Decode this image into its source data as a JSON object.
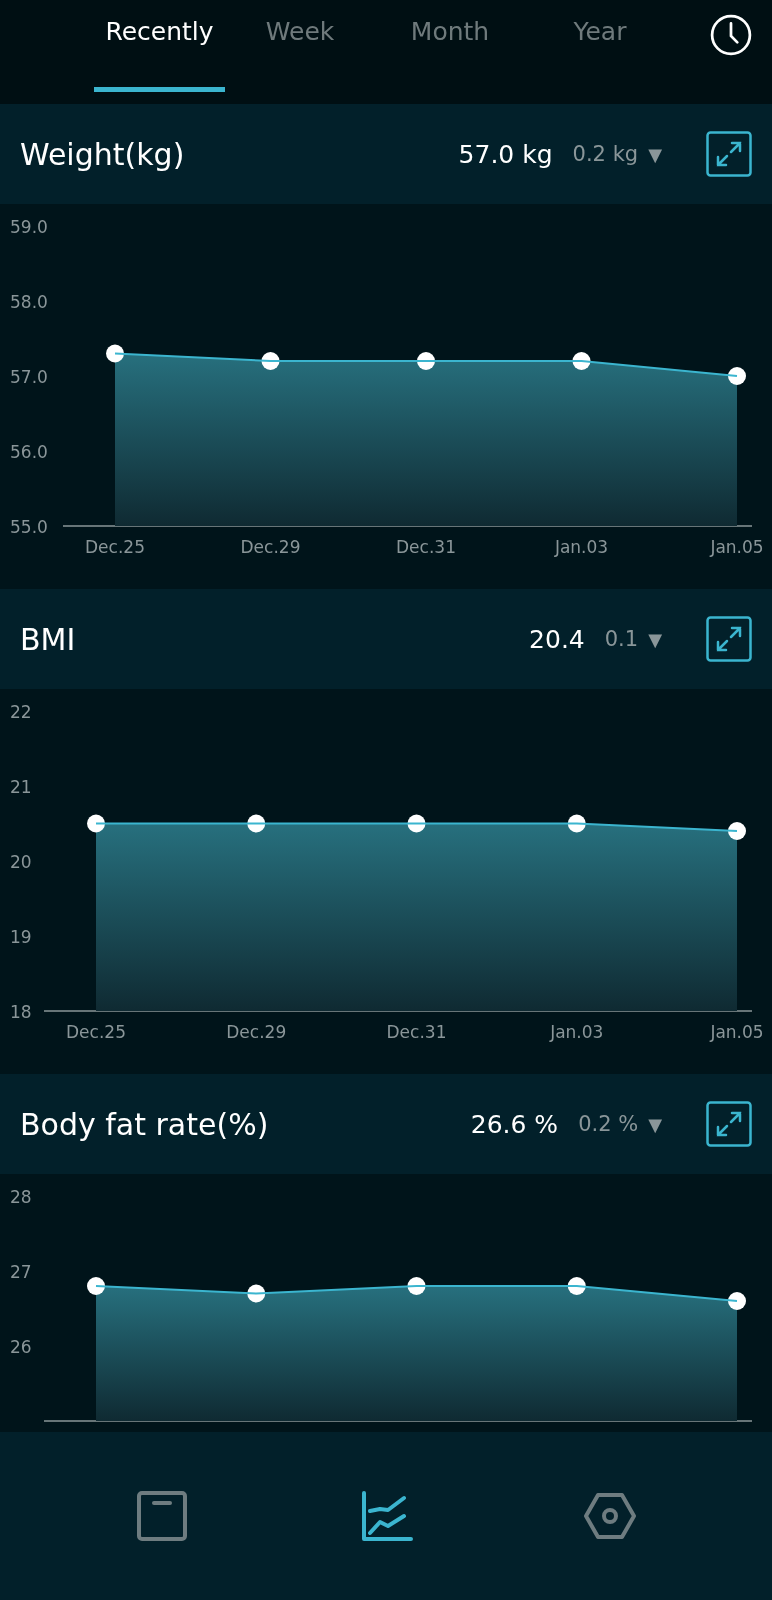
{
  "tabs": [
    {
      "label": "Recently",
      "selected": true
    },
    {
      "label": "Week",
      "selected": false
    },
    {
      "label": "Month",
      "selected": false
    },
    {
      "label": "Year",
      "selected": false
    }
  ],
  "sections": [
    {
      "title": "Weight(kg)",
      "value": "57.0 kg",
      "change": "0.2 kg",
      "trend_icon": "▼",
      "chart_data": {
        "type": "area",
        "categories": [
          "Dec.25",
          "Dec.29",
          "Dec.31",
          "Jan.03",
          "Jan.05"
        ],
        "series": [
          {
            "color": "#3bb5cf",
            "values": [
              57.3,
              57.2,
              57.2,
              57.2,
              57.0
            ]
          }
        ],
        "ylim": [
          55,
          59
        ],
        "yticks": [
          {
            "value": 55,
            "label": "55.0"
          },
          {
            "value": 56,
            "label": "56.0"
          },
          {
            "value": 57,
            "label": "57.0"
          },
          {
            "value": 58,
            "label": "58.0"
          },
          {
            "value": 59,
            "label": "59.0"
          }
        ]
      }
    },
    {
      "title": "BMI",
      "value": "20.4",
      "change": "0.1",
      "trend_icon": "▼",
      "chart_data": {
        "type": "area",
        "categories": [
          "Dec.25",
          "Dec.29",
          "Dec.31",
          "Jan.03",
          "Jan.05"
        ],
        "series": [
          {
            "color": "#3bb5cf",
            "values": [
              20.5,
              20.5,
              20.5,
              20.5,
              20.4
            ]
          }
        ],
        "ylim": [
          18,
          22
        ],
        "yticks": [
          18,
          19,
          20,
          21,
          22
        ]
      }
    },
    {
      "title": "Body fat rate(%)",
      "value": "26.6 %",
      "change": "0.2 %",
      "trend_icon": "▼",
      "chart_data": {
        "type": "area",
        "series": [
          {
            "color": "#3bb5cf",
            "values": [
              26.8,
              26.7,
              26.8,
              26.8,
              26.6
            ]
          }
        ],
        "ylim": [
          25,
          28
        ],
        "yticks": [
          26,
          27,
          28
        ]
      }
    }
  ],
  "bottom_nav": [
    {
      "kind": "scale",
      "selected": false
    },
    {
      "kind": "chart",
      "selected": true
    },
    {
      "kind": "settings",
      "selected": false
    }
  ]
}
